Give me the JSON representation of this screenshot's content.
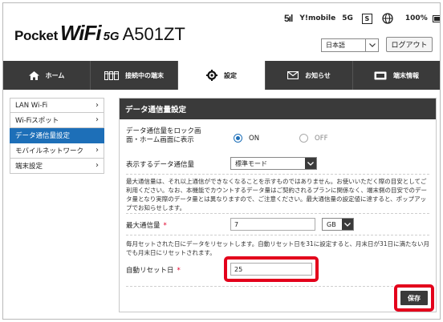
{
  "header": {
    "logo_pocket": "Pocket",
    "logo_wifi": "WiFi",
    "logo_5g": "5G",
    "model": "A501ZT",
    "signal": "5ıl",
    "carrier": "Y!mobile",
    "network": "5G",
    "sim": "S",
    "battery_pct": "100%",
    "battery_level": 1.0,
    "language": "日本語",
    "logout": "ログアウト"
  },
  "nav": {
    "tabs": [
      {
        "label": "ホーム",
        "icon": "home-icon"
      },
      {
        "label": "接続中の端末",
        "icon": "devices-icon"
      },
      {
        "label": "設定",
        "icon": "gear-icon",
        "active": true
      },
      {
        "label": "お知らせ",
        "icon": "mail-icon"
      },
      {
        "label": "端末情報",
        "icon": "device-info-icon"
      }
    ]
  },
  "sidebar": {
    "items": [
      {
        "label": "LAN Wi-Fi"
      },
      {
        "label": "Wi-Fiスポット"
      },
      {
        "label": "データ通信量設定",
        "active": true
      },
      {
        "label": "モバイルネットワーク"
      },
      {
        "label": "端末設定"
      }
    ]
  },
  "main": {
    "title": "データ通信量設定",
    "lock_label": "データ通信量をロック画面・ホーム画面に表示",
    "lock_on": "ON",
    "lock_off": "OFF",
    "display_label": "表示するデータ通信量",
    "display_value": "標準モード",
    "notice": "最大通信量は、それ以上通信ができなくなることを示すものではありません。お使いいただく際の目安としてご利用ください。なお、本機能でカウントするデータ量はご契約されるプランに関係なく、端末側の目安でのデータ量となり実際のデータ量とは異なりますので、ご注意ください。最大通信量の設定値に達すると、ポップアップでお知らせします。",
    "max_label": "最大通信量",
    "max_value": "7",
    "max_unit": "GB",
    "reset_note": "毎月セットされた日にデータをリセットします。自動リセット日を31に設定すると、月末日が31日に満たない月でも月末日にリセットされます。",
    "reset_label": "自動リセット日",
    "reset_value": "25",
    "required_mark": "*",
    "save": "保存"
  }
}
